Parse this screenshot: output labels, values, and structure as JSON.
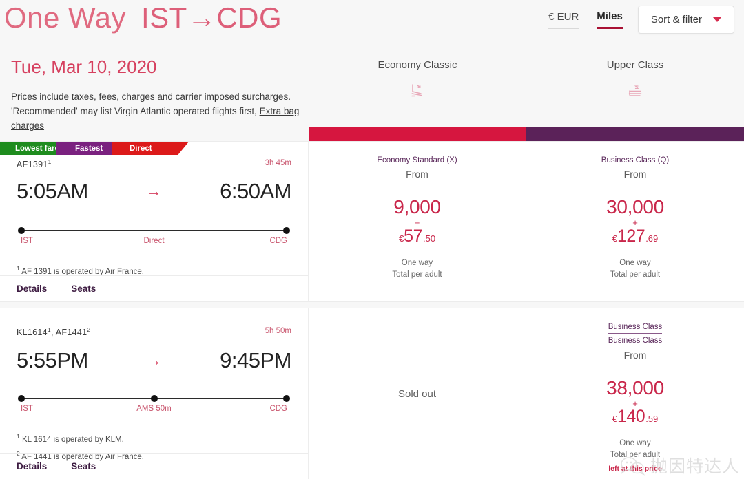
{
  "header": {
    "trip_type": "One Way",
    "route": "IST→CDG",
    "currency_tab": "€ EUR",
    "miles_tab": "Miles",
    "sort_filter": "Sort & filter"
  },
  "info": {
    "date": "Tue, Mar 10, 2020",
    "disclaimer": "Prices include taxes, fees, charges and carrier imposed surcharges. 'Recommended' may list Virgin Atlantic operated flights first,",
    "extra_bag_link": "Extra bag charges"
  },
  "columns": [
    {
      "label": "Economy Classic",
      "icon": "economy-seat-icon",
      "bar_color": "#d6163f"
    },
    {
      "label": "Upper Class",
      "icon": "flat-bed-seat-icon",
      "bar_color": "#5b2259"
    }
  ],
  "badges": [
    {
      "label": "Lowest fare",
      "color": "#1e8c1e"
    },
    {
      "label": "Fastest",
      "color": "#7a217f"
    },
    {
      "label": "Direct",
      "color": "#dc1a1a"
    }
  ],
  "flights": [
    {
      "flight_numbers": "AF1391",
      "flight_sup": "1",
      "duration": "3h 45m",
      "depart_time": "5:05AM",
      "arrive_time": "6:50AM",
      "arrow": "→",
      "origin": "IST",
      "destination": "CDG",
      "stop_label": "Direct",
      "operated_notes": [
        {
          "sup": "1",
          "text": "AF 1391 is operated by Air France."
        }
      ],
      "details_label": "Details",
      "seats_label": "Seats",
      "fares": [
        {
          "fare_links": [
            "Economy Standard (X)"
          ],
          "from_label": "From",
          "miles": "9,000",
          "plus": "+",
          "currency_symbol": "€",
          "amount_major": "57",
          "amount_minor": ".50",
          "per_line_1": "One way",
          "per_line_2": "Total per adult",
          "left_at_price": "",
          "sold_out": ""
        },
        {
          "fare_links": [
            "Business Class (Q)"
          ],
          "from_label": "From",
          "miles": "30,000",
          "plus": "+",
          "currency_symbol": "€",
          "amount_major": "127",
          "amount_minor": ".69",
          "per_line_1": "One way",
          "per_line_2": "Total per adult",
          "left_at_price": "",
          "sold_out": ""
        }
      ]
    },
    {
      "flight_numbers": "KL1614",
      "flight_sup": "1",
      "flight_numbers_2": "AF1441",
      "flight_sup_2": "2",
      "duration": "5h 50m",
      "depart_time": "5:55PM",
      "arrive_time": "9:45PM",
      "arrow": "→",
      "origin": "IST",
      "destination": "CDG",
      "stop_label": "AMS 50m",
      "operated_notes": [
        {
          "sup": "1",
          "text": "KL 1614 is operated by KLM."
        },
        {
          "sup": "2",
          "text": "AF 1441 is operated by Air France."
        }
      ],
      "details_label": "Details",
      "seats_label": "Seats",
      "fares": [
        {
          "fare_links": [],
          "from_label": "",
          "miles": "",
          "plus": "",
          "currency_symbol": "",
          "amount_major": "",
          "amount_minor": "",
          "per_line_1": "",
          "per_line_2": "",
          "left_at_price": "",
          "sold_out": "Sold out"
        },
        {
          "fare_links": [
            "Business Class",
            "Business Class"
          ],
          "from_label": "From",
          "miles": "38,000",
          "plus": "+",
          "currency_symbol": "€",
          "amount_major": "140",
          "amount_minor": ".59",
          "per_line_1": "One way",
          "per_line_2": "Total per adult",
          "left_at_price": "left at this price",
          "sold_out": ""
        }
      ]
    }
  ],
  "watermark": {
    "text": "抛因特达人"
  },
  "colors": {
    "brand_red": "#c9264a",
    "brand_pink": "#d6405f",
    "purple": "#5b2259",
    "crimson": "#d6163f"
  }
}
